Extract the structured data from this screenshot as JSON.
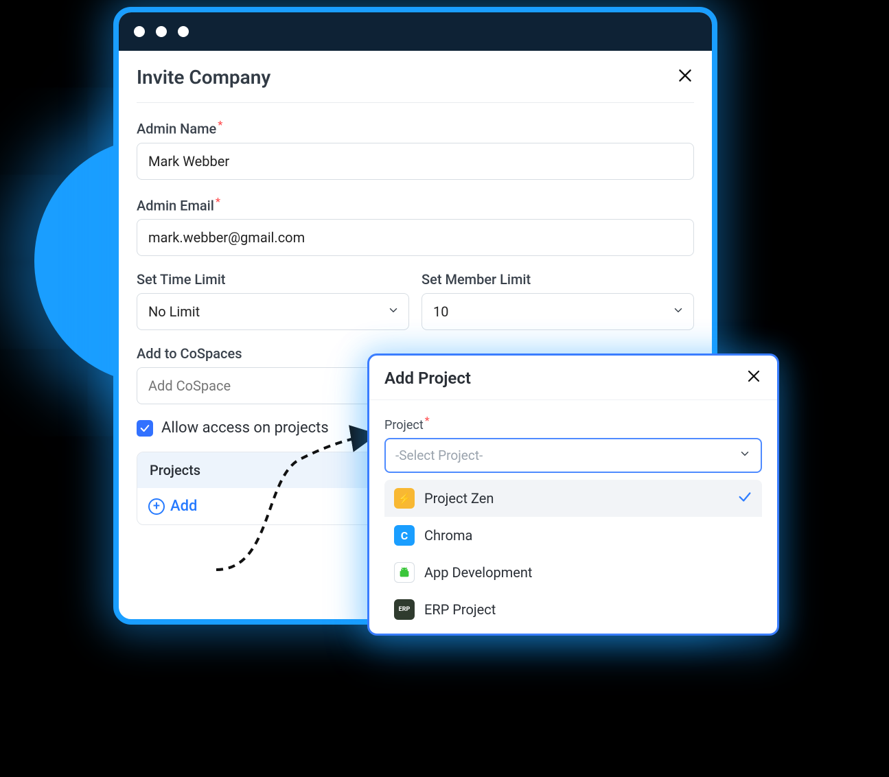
{
  "modal": {
    "title": "Invite Company",
    "admin_name_label": "Admin Name",
    "admin_name_value": "Mark Webber",
    "admin_email_label": "Admin Email",
    "admin_email_value": "mark.webber@gmail.com",
    "time_limit_label": "Set Time Limit",
    "time_limit_value": "No Limit",
    "member_limit_label": "Set Member Limit",
    "member_limit_value": "10",
    "cospaces_label": "Add to CoSpaces",
    "cospaces_placeholder": "Add CoSpace",
    "allow_access_label": "Allow access on projects",
    "projects_header": "Projects",
    "add_label": "Add"
  },
  "popover": {
    "title": "Add Project",
    "project_label": "Project",
    "project_placeholder": "-Select Project-",
    "options": [
      {
        "label": "Project Zen",
        "badge": "⚡",
        "color_class": "b-zen",
        "selected": true
      },
      {
        "label": "Chroma",
        "badge": "C",
        "color_class": "b-chroma",
        "selected": false
      },
      {
        "label": "App Development",
        "badge": "",
        "color_class": "b-app",
        "selected": false,
        "icon": "android"
      },
      {
        "label": "ERP Project",
        "badge": "ERP",
        "color_class": "b-erp",
        "selected": false
      }
    ]
  }
}
